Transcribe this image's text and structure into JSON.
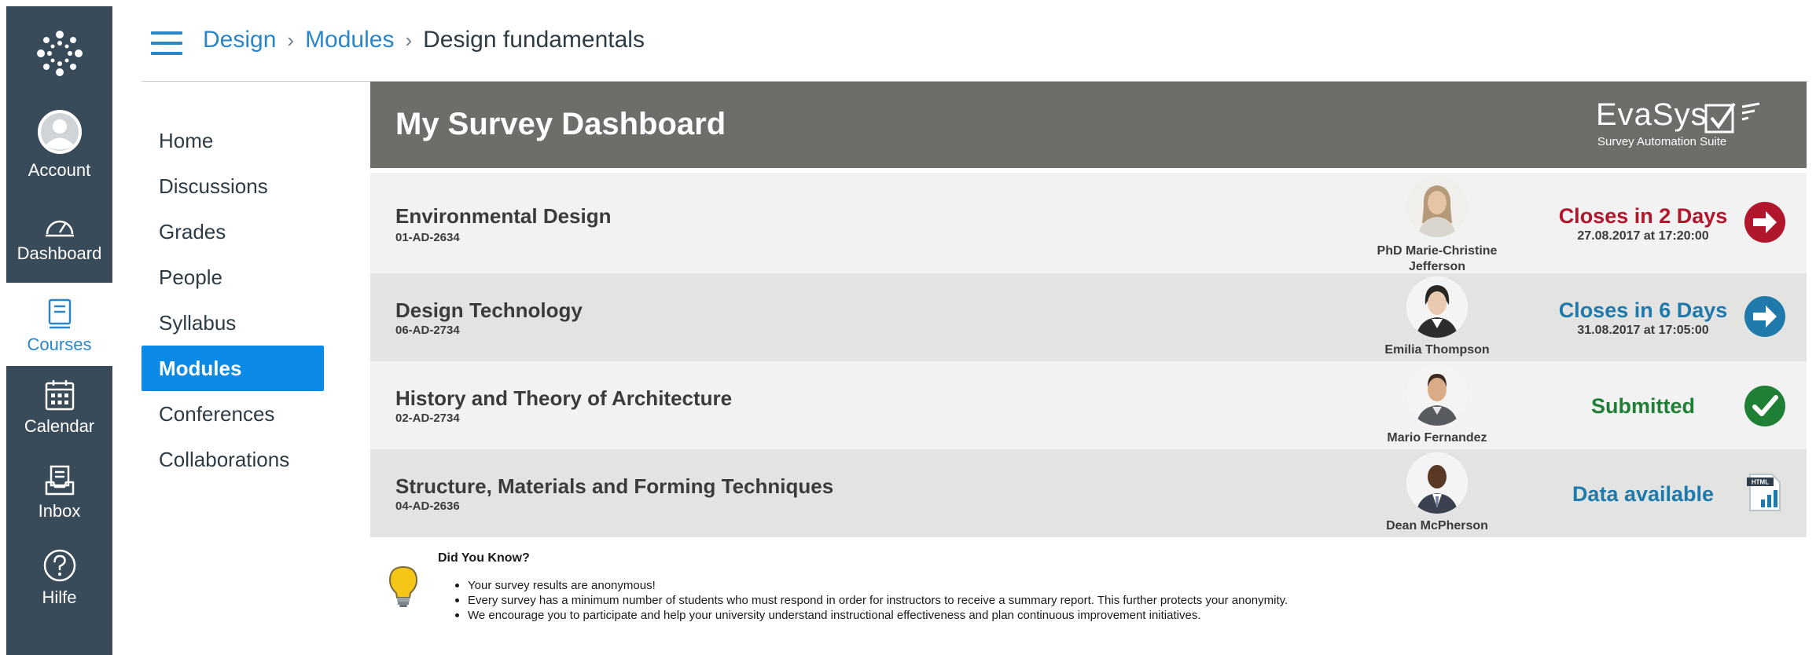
{
  "global_nav": {
    "items": [
      {
        "key": "account",
        "label": "Account",
        "icon": "account-icon"
      },
      {
        "key": "dashboard",
        "label": "Dashboard",
        "icon": "dashboard-icon"
      },
      {
        "key": "courses",
        "label": "Courses",
        "icon": "courses-icon",
        "active": true
      },
      {
        "key": "calendar",
        "label": "Calendar",
        "icon": "calendar-icon"
      },
      {
        "key": "inbox",
        "label": "Inbox",
        "icon": "inbox-icon"
      },
      {
        "key": "help",
        "label": "Hilfe",
        "icon": "help-icon"
      }
    ]
  },
  "breadcrumb": {
    "items": [
      "Design",
      "Modules",
      "Design fundamentals"
    ],
    "separator": "›"
  },
  "course_nav": {
    "items": [
      "Home",
      "Discussions",
      "Grades",
      "People",
      "Syllabus",
      "Modules",
      "Conferences",
      "Collaborations"
    ],
    "active": "Modules"
  },
  "dashboard": {
    "title": "My Survey Dashboard",
    "brand": {
      "name": "EvaSys",
      "tagline": "Survey Automation Suite"
    },
    "surveys": [
      {
        "course": "Environmental Design",
        "code": "01-AD-2634",
        "teacher": "PhD Marie-Christine Jefferson",
        "status": "Closes in 2 Days",
        "status_detail": "27.08.2017 at 17:20:00",
        "status_color": "#b0162c",
        "icon": "arrow-right-red-icon"
      },
      {
        "course": "Design Technology",
        "code": "06-AD-2734",
        "teacher": "Emilia Thompson",
        "status": "Closes in 6 Days",
        "status_detail": "31.08.2017 at 17:05:00",
        "status_color": "#1f7aab",
        "icon": "arrow-right-blue-icon"
      },
      {
        "course": "History and Theory of Architecture",
        "code": "02-AD-2734",
        "teacher": "Mario Fernandez",
        "status": "Submitted",
        "status_detail": "",
        "status_color": "#1e7f35",
        "icon": "check-green-icon"
      },
      {
        "course": "Structure, Materials and Forming Techniques",
        "code": "04-AD-2636",
        "teacher": "Dean McPherson",
        "status": "Data available",
        "status_detail": "",
        "status_color": "#1f7aab",
        "icon": "html-report-icon"
      }
    ],
    "did_you_know": {
      "title": "Did You Know?",
      "items": [
        "Your survey results are anonymous!",
        "Every survey has a minimum number of students who must respond in order for instructors to receive a summary report. This further protects your anonymity.",
        "We encourage you to participate and help your university understand instructional effectiveness and plan continuous improvement initiatives."
      ]
    }
  },
  "colors": {
    "global_nav_bg": "#394b58",
    "link_blue": "#2b86c8",
    "active_module_bg": "#0a8ae6",
    "dashboard_header_bg": "#6f6d69"
  }
}
